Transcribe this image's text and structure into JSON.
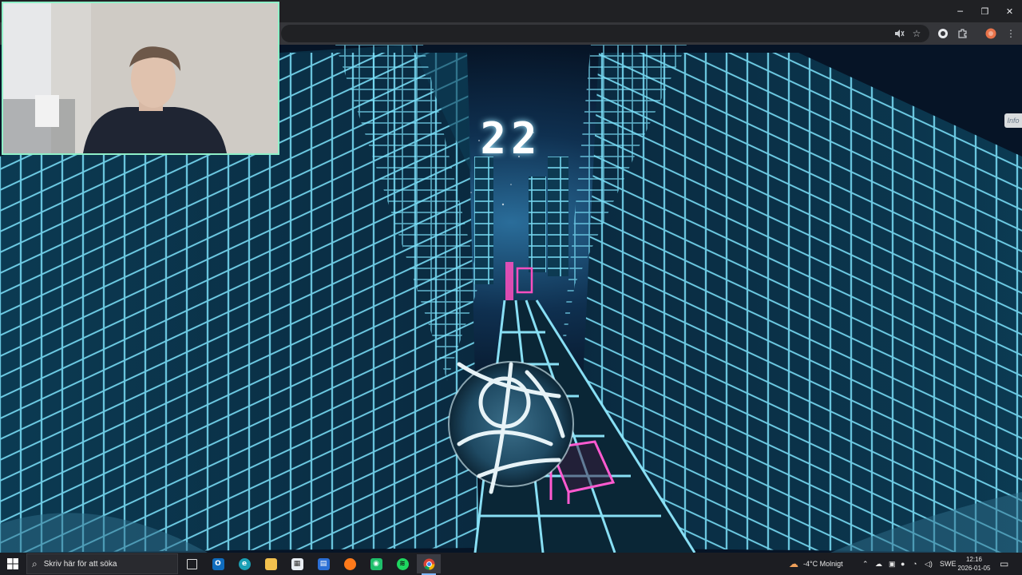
{
  "browser": {
    "controls": {
      "minimize": "─",
      "maximize": "❐",
      "close": "✕"
    },
    "toolbar_icons": [
      "mute-tab-icon",
      "bookmark-star-icon",
      "extension-icon",
      "puzzle-icon",
      "profile-avatar-icon",
      "menu-icon"
    ]
  },
  "game": {
    "score": "22",
    "info_label": "Info",
    "colors": {
      "grid": "#7fe6ff",
      "accent": "#ff4fc0",
      "sky": "#0b1d34"
    }
  },
  "webcam": {
    "label": "webcam-overlay"
  },
  "taskbar": {
    "search_placeholder": "Skriv här för att söka",
    "apps": [
      "task-view-icon",
      "outlook-icon",
      "edge-icon",
      "file-explorer-icon",
      "calendar-app-icon",
      "store-icon",
      "firefox-icon",
      "camera-app-icon",
      "spotify-icon",
      "chrome-icon"
    ],
    "weather": "-4°C  Molnigt",
    "language": "SWE",
    "time": "12:16",
    "date": "2026-01-05"
  }
}
